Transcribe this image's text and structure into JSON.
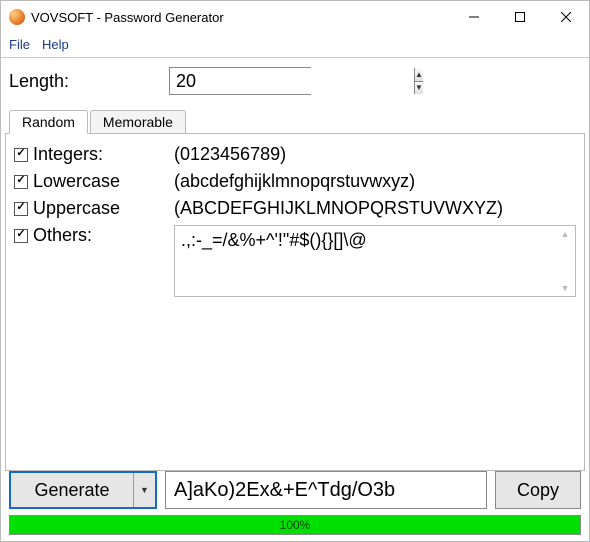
{
  "titlebar": {
    "title": "VOVSOFT - Password Generator"
  },
  "menubar": {
    "file": "File",
    "help": "Help"
  },
  "length": {
    "label": "Length:",
    "value": "20"
  },
  "tabs": {
    "random": "Random",
    "memorable": "Memorable"
  },
  "options": {
    "integers": {
      "label": "Integers:",
      "chars": "(0123456789)"
    },
    "lowercase": {
      "label": "Lowercase",
      "chars": "(abcdefghijklmnopqrstuvwxyz)"
    },
    "uppercase": {
      "label": "Uppercase",
      "chars": "(ABCDEFGHIJKLMNOPQRSTUVWXYZ)"
    },
    "others": {
      "label": "Others:",
      "chars": ".,:-_=/&%+^'!\"#$(){}[]\\@"
    }
  },
  "generate": {
    "label": "Generate"
  },
  "output": {
    "value": "A]aKo)2Ex&+E^Tdg/O3b"
  },
  "copy": {
    "label": "Copy"
  },
  "progress": {
    "text": "100%"
  }
}
